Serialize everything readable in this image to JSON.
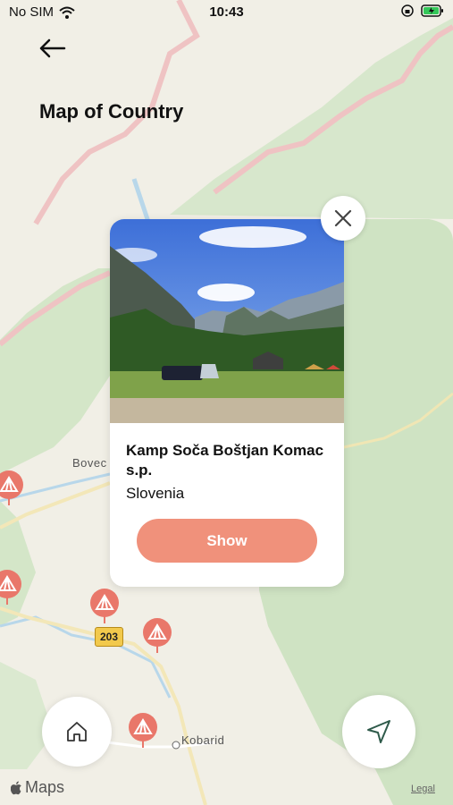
{
  "status_bar": {
    "carrier": "No SIM",
    "time": "10:43"
  },
  "header": {
    "title": "Map of Country"
  },
  "map": {
    "places": [
      "Bovec",
      "Kobarid"
    ],
    "road_number": "203"
  },
  "card": {
    "name": "Kamp Soča Boštjan Komac s.p.",
    "country": "Slovenia",
    "show_label": "Show"
  },
  "footer": {
    "maps_brand": "Maps",
    "legal_label": "Legal"
  },
  "colors": {
    "accent": "#f0917b",
    "pin": "#e9776a",
    "map_land": "#f1efe6",
    "map_green": "#cfe3c3"
  },
  "icons": [
    "back-arrow-icon",
    "close-icon",
    "home-icon",
    "navigation-icon",
    "camp-pin-icon",
    "apple-icon",
    "wifi-icon",
    "battery-icon"
  ]
}
